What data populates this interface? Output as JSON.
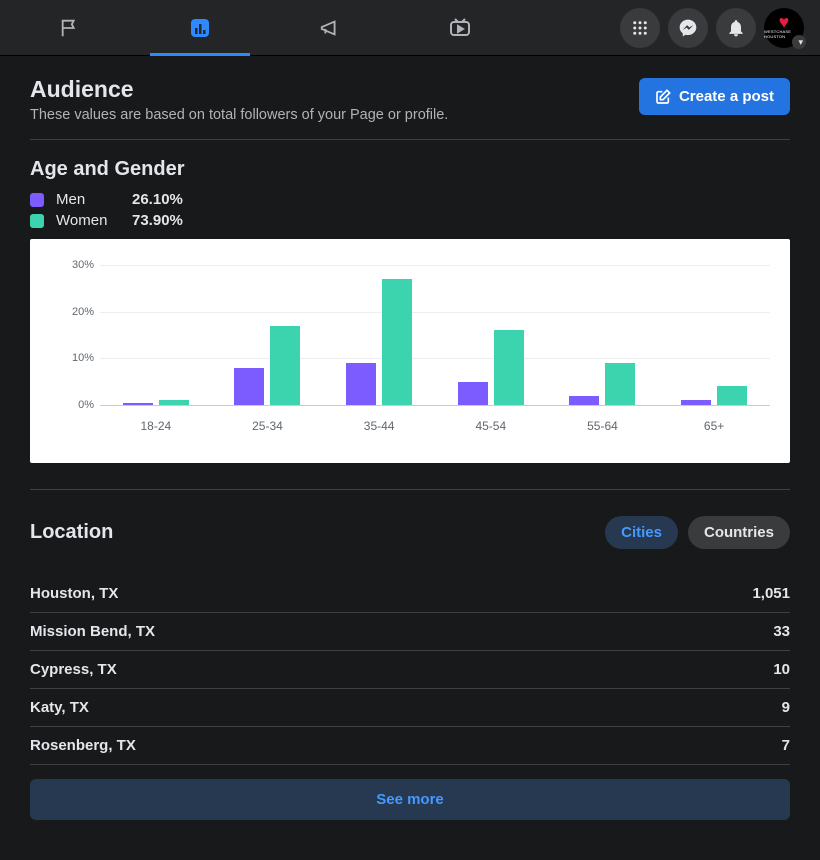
{
  "nav": {
    "tabs": [
      "flag",
      "insights",
      "announcements",
      "video"
    ],
    "active_index": 1
  },
  "header": {
    "title": "Audience",
    "subtitle": "These values are based on total followers of your Page or profile.",
    "create_post_label": "Create a post"
  },
  "age_gender": {
    "section_title": "Age and Gender",
    "legend": [
      {
        "label": "Men",
        "value": "26.10%"
      },
      {
        "label": "Women",
        "value": "73.90%"
      }
    ]
  },
  "chart_data": {
    "type": "bar",
    "categories": [
      "18-24",
      "25-34",
      "35-44",
      "45-54",
      "55-64",
      "65+"
    ],
    "series": [
      {
        "name": "Men",
        "color": "#7c5cff",
        "values": [
          0.5,
          8,
          9,
          5,
          2,
          1
        ]
      },
      {
        "name": "Women",
        "color": "#3bd4ae",
        "values": [
          1,
          17,
          27,
          16,
          9,
          4
        ]
      }
    ],
    "ylabel": "%",
    "ylim": [
      0,
      30
    ],
    "yticks": [
      0,
      10,
      20,
      30
    ],
    "ytick_labels": [
      "0%",
      "10%",
      "20%",
      "30%"
    ]
  },
  "location": {
    "section_title": "Location",
    "tabs": {
      "cities": "Cities",
      "countries": "Countries",
      "active": "cities"
    },
    "rows": [
      {
        "name": "Houston, TX",
        "value": "1,051"
      },
      {
        "name": "Mission Bend, TX",
        "value": "33"
      },
      {
        "name": "Cypress, TX",
        "value": "10"
      },
      {
        "name": "Katy, TX",
        "value": "9"
      },
      {
        "name": "Rosenberg, TX",
        "value": "7"
      }
    ],
    "see_more_label": "See more"
  }
}
